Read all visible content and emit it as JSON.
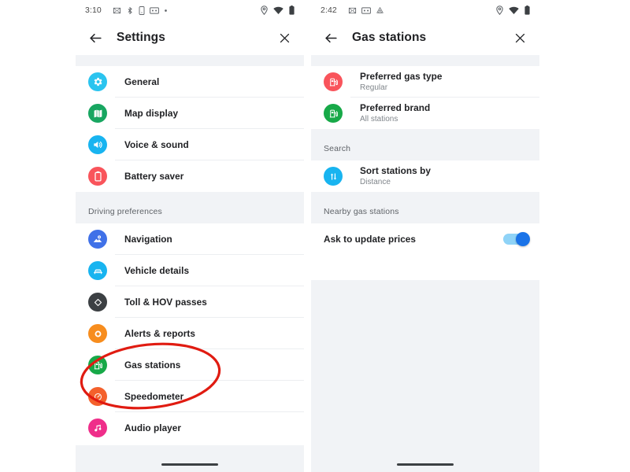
{
  "left_phone": {
    "status_bar": {
      "clock": "3:10",
      "left_icons": [
        "messages-icon",
        "bluetooth-icon",
        "vibrate-icon",
        "sim-icon",
        "dot-icon"
      ],
      "right_icons": [
        "location-icon",
        "wifi-icon",
        "battery-icon"
      ]
    },
    "app_bar": {
      "back_icon": "arrow-back-icon",
      "title": "Settings",
      "close_icon": "close-icon"
    },
    "sections": [
      {
        "header": "",
        "items": [
          {
            "title": "General",
            "subtitle": "",
            "icon": "gear-icon",
            "color": "#2bc4ef"
          },
          {
            "title": "Map display",
            "subtitle": "",
            "icon": "map-icon",
            "color": "#18a661"
          },
          {
            "title": "Voice & sound",
            "subtitle": "",
            "icon": "speaker-icon",
            "color": "#18b4f0"
          },
          {
            "title": "Battery saver",
            "subtitle": "",
            "icon": "battery-icon",
            "color": "#f9545b"
          }
        ]
      },
      {
        "header": "Driving preferences",
        "items": [
          {
            "title": "Navigation",
            "subtitle": "",
            "icon": "navigation-map-icon",
            "color": "#4071e8"
          },
          {
            "title": "Vehicle details",
            "subtitle": "",
            "icon": "car-icon",
            "color": "#18b4f0"
          },
          {
            "title": "Toll & HOV passes",
            "subtitle": "",
            "icon": "diamond-icon",
            "color": "#3c4043"
          },
          {
            "title": "Alerts & reports",
            "subtitle": "",
            "icon": "alert-target-icon",
            "color": "#f78d1e"
          },
          {
            "title": "Gas stations",
            "subtitle": "",
            "icon": "gas-pump-icon",
            "color": "#17a948"
          },
          {
            "title": "Speedometer",
            "subtitle": "",
            "icon": "speedometer-icon",
            "color": "#f4612c"
          },
          {
            "title": "Audio player",
            "subtitle": "",
            "icon": "music-note-icon",
            "color": "#ef2e8a"
          }
        ]
      }
    ]
  },
  "right_phone": {
    "status_bar": {
      "clock": "2:42",
      "left_icons": [
        "messages-icon",
        "sim-icon",
        "drive-icon"
      ],
      "right_icons": [
        "location-icon",
        "wifi-icon",
        "battery-icon"
      ]
    },
    "app_bar": {
      "back_icon": "arrow-back-icon",
      "title": "Gas stations",
      "close_icon": "close-icon"
    },
    "sections": [
      {
        "header": "",
        "items": [
          {
            "title": "Preferred gas type",
            "subtitle": "Regular",
            "icon": "gas-pump-icon",
            "color": "#f9545b"
          },
          {
            "title": "Preferred brand",
            "subtitle": "All stations",
            "icon": "gas-pump-icon",
            "color": "#17a948"
          }
        ]
      },
      {
        "header": "Search",
        "items": [
          {
            "title": "Sort stations by",
            "subtitle": "Distance",
            "icon": "sort-arrows-icon",
            "color": "#18b4f0"
          }
        ]
      },
      {
        "header": "Nearby gas stations",
        "toggle_row": {
          "title": "Ask to update prices",
          "state": "on",
          "track_color": "#8fd3f7",
          "knob_color": "#1a73e8"
        }
      }
    ]
  },
  "annotation": {
    "shape": "ellipse",
    "color": "#e01b11",
    "target_label": "Gas stations"
  }
}
